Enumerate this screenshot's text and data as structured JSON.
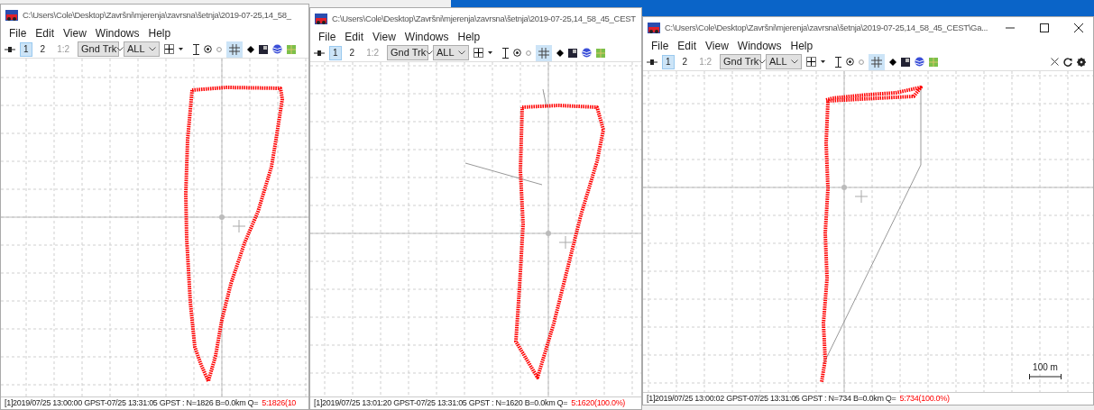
{
  "windows": [
    {
      "title": "C:\\Users\\Cole\\Desktop\\Završni\\mjerenja\\zavrsna\\šetnja\\2019-07-25,14_58_",
      "menu": [
        "File",
        "Edit",
        "View",
        "Windows",
        "Help"
      ],
      "plot_buttons": [
        {
          "label": "1",
          "selected": true
        },
        {
          "label": "2",
          "selected": false
        },
        {
          "label": "1:2",
          "selected": false
        }
      ],
      "plot_type": "Gnd Trk",
      "satellites": "ALL",
      "grid_on": true,
      "status": "[1]2019/07/25 13:00:00 GPST-07/25 13:31:05 GPST : N=1826 B=0.0km Q=",
      "quality": "5:1826(10"
    },
    {
      "title": "C:\\Users\\Cole\\Desktop\\Završni\\mjerenja\\zavrsna\\šetnja\\2019-07-25,14_58_45_CEST",
      "menu": [
        "File",
        "Edit",
        "View",
        "Windows",
        "Help"
      ],
      "plot_buttons": [
        {
          "label": "1",
          "selected": true
        },
        {
          "label": "2",
          "selected": false
        },
        {
          "label": "1:2",
          "selected": false
        }
      ],
      "plot_type": "Gnd Trk",
      "satellites": "ALL",
      "grid_on": true,
      "status": "[1]2019/07/25 13:01:20 GPST-07/25 13:31:05 GPST : N=1620 B=0.0km Q=",
      "quality": "5:1620(100.0%)"
    },
    {
      "title": "C:\\Users\\Cole\\Desktop\\Završni\\mjerenja\\zavrsna\\šetnja\\2019-07-25,14_58_45_CEST\\Ga...",
      "menu": [
        "File",
        "Edit",
        "View",
        "Windows",
        "Help"
      ],
      "plot_buttons": [
        {
          "label": "1",
          "selected": true
        },
        {
          "label": "2",
          "selected": false
        },
        {
          "label": "1:2",
          "selected": false
        }
      ],
      "plot_type": "Gnd Trk",
      "satellites": "ALL",
      "grid_on": true,
      "title_buttons": true,
      "toolbar_end_icons": true,
      "scale": "100 m",
      "status": "[1]2019/07/25 13:00:02 GPST-07/25 13:31:05 GPST : N=734 B=0.0km Q=",
      "quality": "5:734(100.0%)"
    }
  ]
}
